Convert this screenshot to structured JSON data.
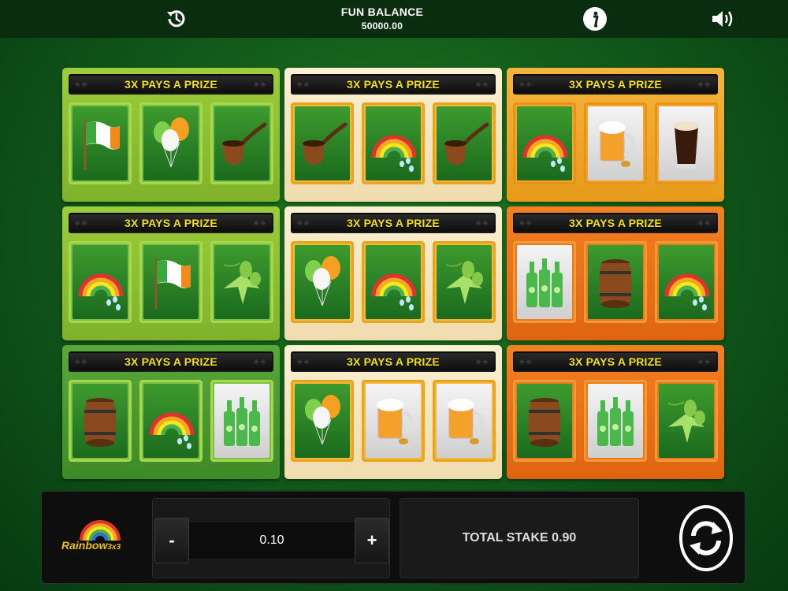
{
  "header": {
    "balance_label": "FUN BALANCE",
    "balance_value": "50000.00",
    "history_icon": "history-icon",
    "info_icon": "info-icon",
    "sound_icon": "speaker-icon"
  },
  "cards": [
    {
      "banner": "3X PAYS A PRIZE",
      "theme": "lime",
      "symbols": [
        "flag",
        "balloons",
        "pipe"
      ]
    },
    {
      "banner": "3X PAYS A PRIZE",
      "theme": "cream",
      "symbols": [
        "pipe",
        "rainbow",
        "pipe"
      ]
    },
    {
      "banner": "3X PAYS A PRIZE",
      "theme": "gold",
      "symbols": [
        "rainbow",
        "beer-mug",
        "stout"
      ]
    },
    {
      "banner": "3X PAYS A PRIZE",
      "theme": "lime",
      "symbols": [
        "rainbow",
        "flag",
        "hops"
      ]
    },
    {
      "banner": "3X PAYS A PRIZE",
      "theme": "cream",
      "symbols": [
        "balloons",
        "rainbow",
        "hops"
      ]
    },
    {
      "banner": "3X PAYS A PRIZE",
      "theme": "orange",
      "symbols": [
        "bottles",
        "barrel",
        "rainbow"
      ]
    },
    {
      "banner": "3X PAYS A PRIZE",
      "theme": "lime2",
      "symbols": [
        "barrel",
        "rainbow",
        "bottles"
      ]
    },
    {
      "banner": "3X PAYS A PRIZE",
      "theme": "cream",
      "symbols": [
        "balloons",
        "beer-mug",
        "beer-mug"
      ]
    },
    {
      "banner": "3X PAYS A PRIZE",
      "theme": "orange",
      "symbols": [
        "barrel",
        "bottles",
        "hops"
      ]
    }
  ],
  "controls": {
    "logo_text": "Rainbow",
    "logo_suffix": "3x3",
    "minus_label": "-",
    "plus_label": "+",
    "bet_value": "0.10",
    "total_stake": "TOTAL STAKE 0.90",
    "play_icon": "refresh-play-icon"
  }
}
